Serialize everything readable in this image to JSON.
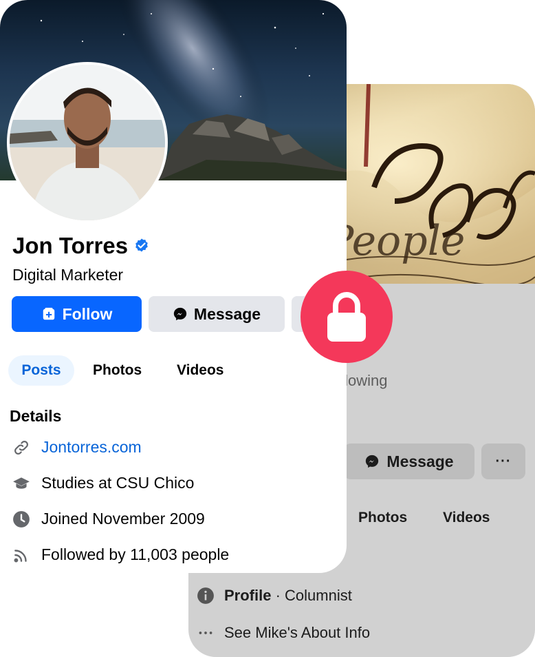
{
  "front_profile": {
    "name": "Jon Torres",
    "subtitle": "Digital Marketer",
    "buttons": {
      "follow": "Follow",
      "message": "Message"
    },
    "tabs": [
      "Posts",
      "Photos",
      "Videos"
    ],
    "details_title": "Details",
    "details": [
      {
        "icon": "link-icon",
        "text": "Jontorres.com"
      },
      {
        "icon": "graduation-cap-icon",
        "text": "Studies at CSU Chico"
      },
      {
        "icon": "clock-icon",
        "text": "Joined November 2009"
      },
      {
        "icon": "rss-icon",
        "text": "Followed by 11,003 people"
      }
    ]
  },
  "back_profile": {
    "cover_script_text": "People",
    "following_fragment": "ollowing",
    "message_label": "Message",
    "more_label": "···",
    "tabs": [
      "Photos",
      "Videos"
    ],
    "profile_label": "Profile",
    "profile_role": "· Columnist",
    "about_link": "See Mike's About Info"
  },
  "colors": {
    "follow_button": "#0866ff",
    "link_blue": "#0864d8",
    "verified_badge": "#1877f2",
    "lock_badge": "#f4385a",
    "back_card": "#d1d1d1"
  }
}
